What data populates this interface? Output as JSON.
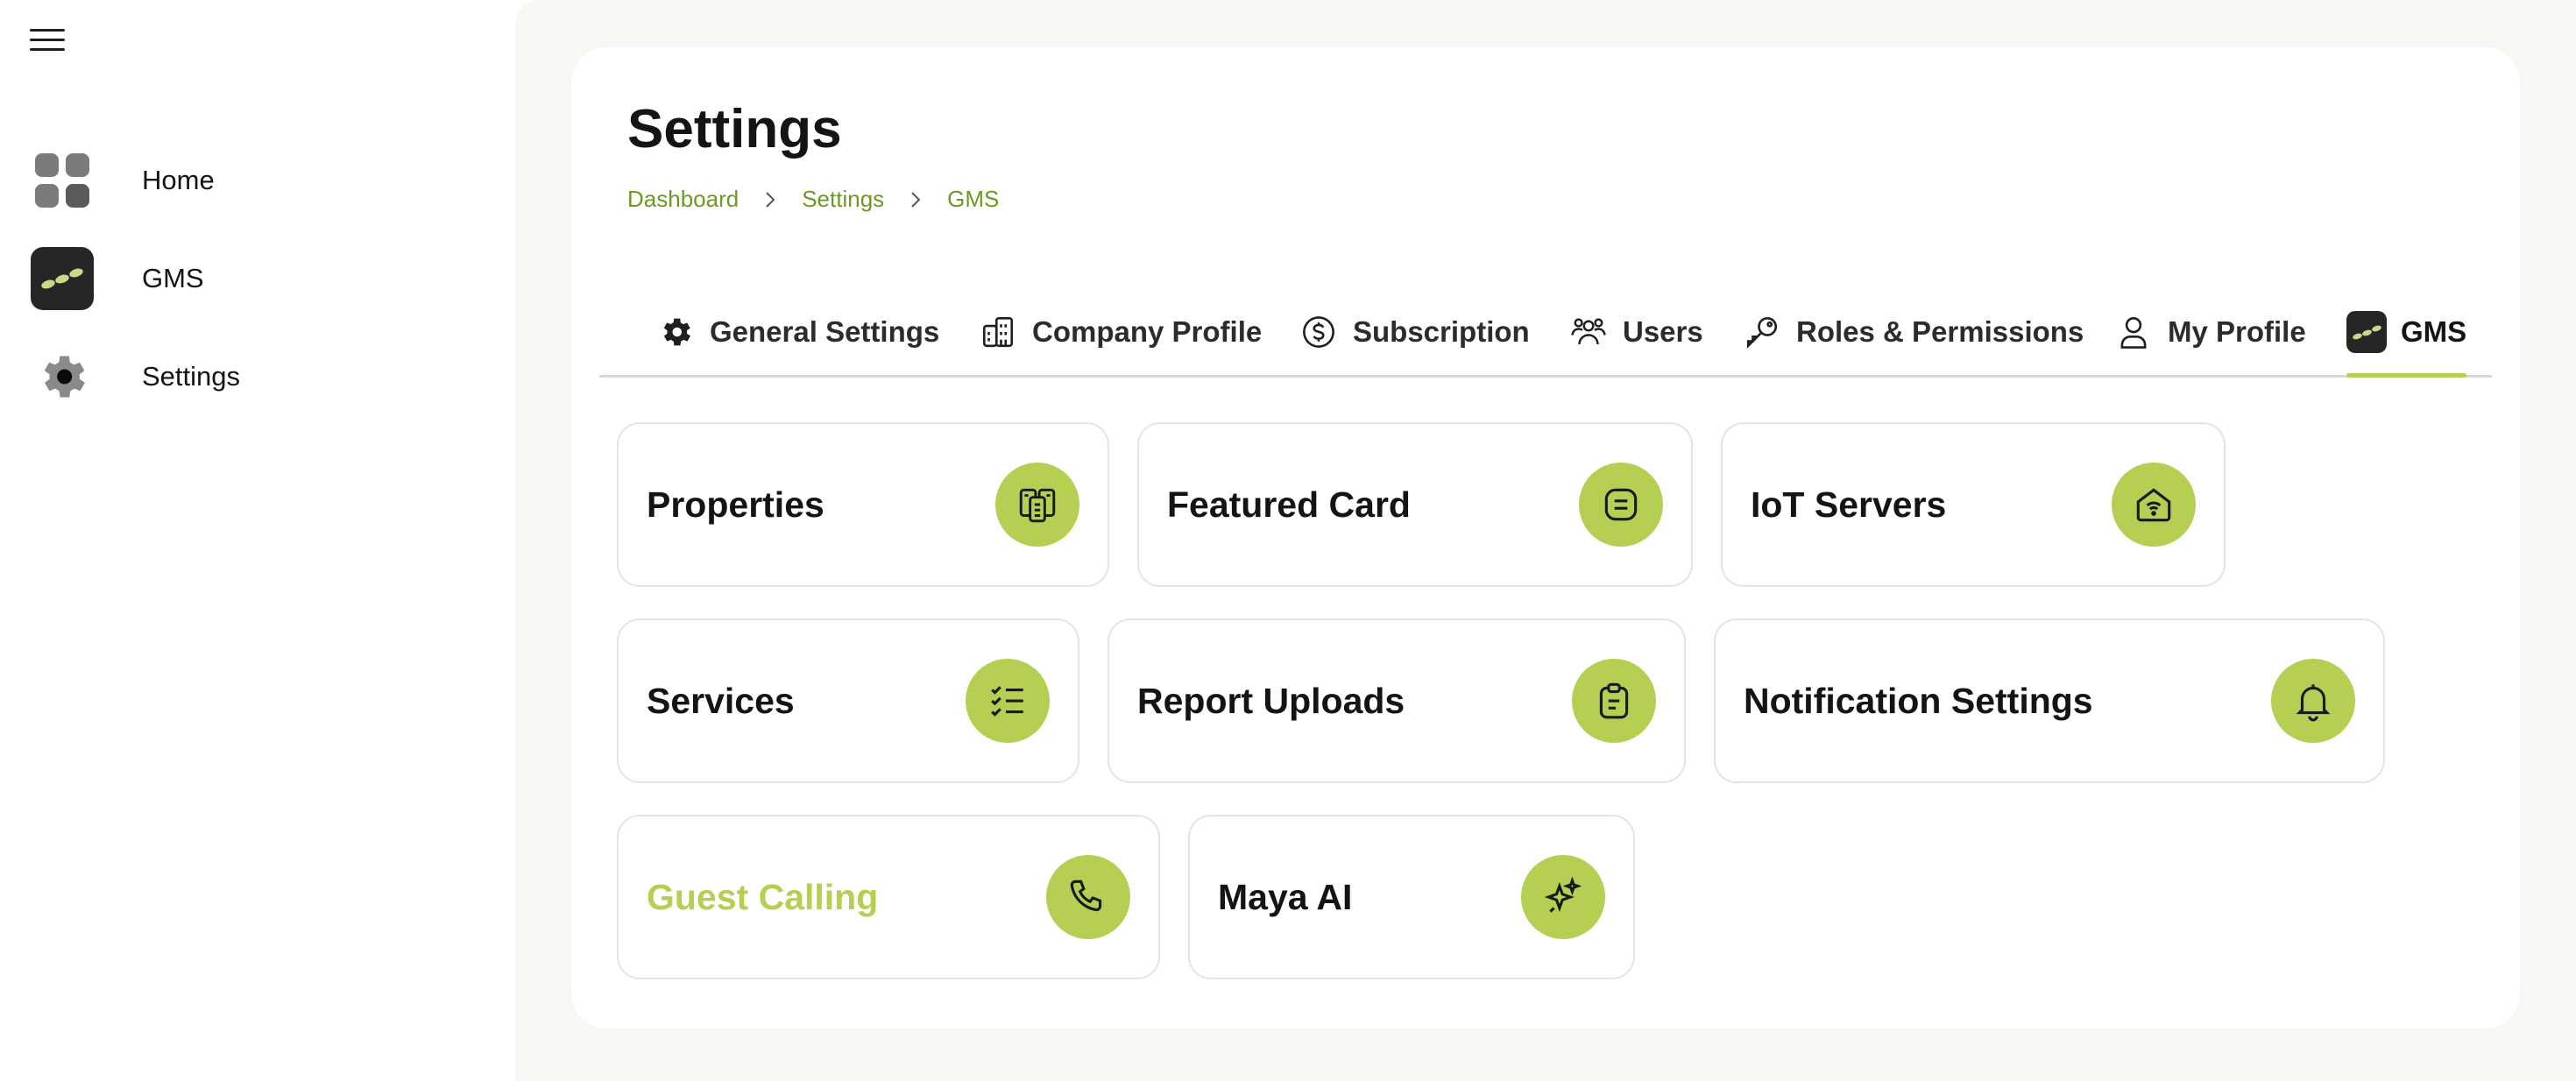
{
  "sidebar": {
    "items": [
      {
        "label": "Home",
        "icon": "grid-icon"
      },
      {
        "label": "GMS",
        "icon": "gms-logo-icon"
      },
      {
        "label": "Settings",
        "icon": "gear-icon"
      }
    ]
  },
  "header": {
    "title": "Settings",
    "breadcrumb": [
      "Dashboard",
      "Settings",
      "GMS"
    ]
  },
  "tabs": [
    {
      "label": "General Settings",
      "icon": "gear-icon"
    },
    {
      "label": "Company Profile",
      "icon": "building-icon"
    },
    {
      "label": "Subscription",
      "icon": "dollar-circle-icon"
    },
    {
      "label": "Users",
      "icon": "users-icon"
    },
    {
      "label": "Roles & Permissions",
      "icon": "key-icon"
    },
    {
      "label": "My Profile",
      "icon": "person-icon"
    },
    {
      "label": "GMS",
      "icon": "gms-logo-icon",
      "active": true
    }
  ],
  "tiles": [
    {
      "label": "Properties",
      "icon": "properties-icon"
    },
    {
      "label": "Featured Card",
      "icon": "card-icon"
    },
    {
      "label": "IoT Servers",
      "icon": "house-wifi-icon"
    },
    {
      "label": "Services",
      "icon": "checklist-icon"
    },
    {
      "label": "Report Uploads",
      "icon": "clipboard-icon"
    },
    {
      "label": "Notification Settings",
      "icon": "bell-icon"
    },
    {
      "label": "Guest Calling",
      "icon": "phone-icon",
      "highlighted": true
    },
    {
      "label": "Maya AI",
      "icon": "sparkle-icon"
    }
  ],
  "colors": {
    "accent": "#b5cf52",
    "breadcrumb": "#6a9a1f",
    "background": "#f7f7f3",
    "text": "#141414"
  }
}
